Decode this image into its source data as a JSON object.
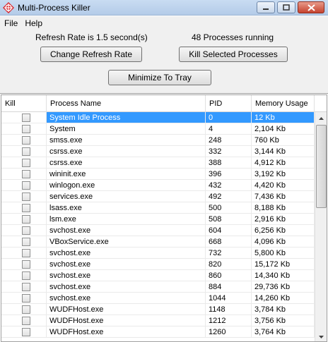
{
  "window": {
    "title": "Multi-Process Killer",
    "accent_color": "#3399ff",
    "icon": "crosshair-diamond-icon"
  },
  "menu": [
    "File",
    "Help"
  ],
  "status": {
    "refresh_rate": "Refresh Rate is 1.5 second(s)",
    "process_count": "48 Processes running"
  },
  "buttons": {
    "change_refresh": "Change Refresh Rate",
    "kill_selected": "Kill Selected Processes",
    "minimize_tray": "Minimize To Tray"
  },
  "table": {
    "columns": [
      "Kill",
      "Process Name",
      "PID",
      "Memory Usage"
    ],
    "selected_row": 0,
    "rows": [
      {
        "name": "System Idle Process",
        "pid": "0",
        "mem": "12 Kb"
      },
      {
        "name": "System",
        "pid": "4",
        "mem": "2,104 Kb"
      },
      {
        "name": "smss.exe",
        "pid": "248",
        "mem": "760 Kb"
      },
      {
        "name": "csrss.exe",
        "pid": "332",
        "mem": "3,144 Kb"
      },
      {
        "name": "csrss.exe",
        "pid": "388",
        "mem": "4,912 Kb"
      },
      {
        "name": "wininit.exe",
        "pid": "396",
        "mem": "3,192 Kb"
      },
      {
        "name": "winlogon.exe",
        "pid": "432",
        "mem": "4,420 Kb"
      },
      {
        "name": "services.exe",
        "pid": "492",
        "mem": "7,436 Kb"
      },
      {
        "name": "lsass.exe",
        "pid": "500",
        "mem": "8,188 Kb"
      },
      {
        "name": "lsm.exe",
        "pid": "508",
        "mem": "2,916 Kb"
      },
      {
        "name": "svchost.exe",
        "pid": "604",
        "mem": "6,256 Kb"
      },
      {
        "name": "VBoxService.exe",
        "pid": "668",
        "mem": "4,096 Kb"
      },
      {
        "name": "svchost.exe",
        "pid": "732",
        "mem": "5,800 Kb"
      },
      {
        "name": "svchost.exe",
        "pid": "820",
        "mem": "15,172 Kb"
      },
      {
        "name": "svchost.exe",
        "pid": "860",
        "mem": "14,340 Kb"
      },
      {
        "name": "svchost.exe",
        "pid": "884",
        "mem": "29,736 Kb"
      },
      {
        "name": "svchost.exe",
        "pid": "1044",
        "mem": "14,260 Kb"
      },
      {
        "name": "WUDFHost.exe",
        "pid": "1148",
        "mem": "3,784 Kb"
      },
      {
        "name": "WUDFHost.exe",
        "pid": "1212",
        "mem": "3,756 Kb"
      },
      {
        "name": "WUDFHost.exe",
        "pid": "1260",
        "mem": "3,764 Kb"
      }
    ]
  }
}
